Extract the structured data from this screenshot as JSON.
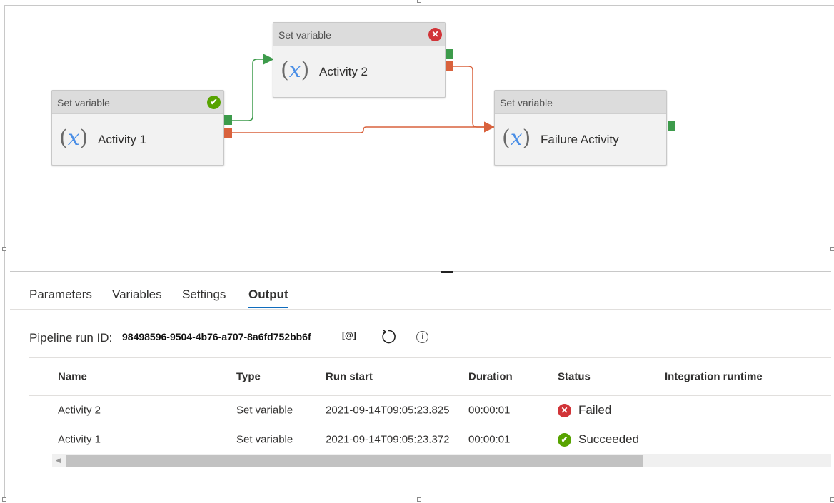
{
  "canvas": {
    "nodes": [
      {
        "id": "activity-1",
        "header": "Set variable",
        "name": "Activity 1",
        "fx_open": "(",
        "fx_var": "x",
        "fx_close": ")",
        "status": "succeeded"
      },
      {
        "id": "activity-2",
        "header": "Set variable",
        "name": "Activity 2",
        "fx_open": "(",
        "fx_var": "x",
        "fx_close": ")",
        "status": "failed"
      },
      {
        "id": "failure-activity",
        "header": "Set variable",
        "name": "Failure Activity",
        "fx_open": "(",
        "fx_var": "x",
        "fx_close": ")",
        "status": "none"
      }
    ],
    "status_glyphs": {
      "succeeded": "✔",
      "failed": "✕"
    },
    "colors": {
      "success": "#3d9b4b",
      "failure": "#d9623d",
      "failed_icon": "#d13438",
      "success_icon": "#57a300"
    }
  },
  "tabs": [
    {
      "label": "Parameters",
      "active": false
    },
    {
      "label": "Variables",
      "active": false
    },
    {
      "label": "Settings",
      "active": false
    },
    {
      "label": "Output",
      "active": true
    }
  ],
  "pipeline": {
    "run_id_label": "Pipeline run ID:",
    "run_id": "98498596-9504-4b76-a707-8a6fd752bb6f",
    "copy_icon_glyph": "[@]"
  },
  "table": {
    "columns": [
      "Name",
      "Type",
      "Run start",
      "Duration",
      "Status",
      "Integration runtime"
    ],
    "rows": [
      {
        "name": "Activity 2",
        "type": "Set variable",
        "run_start": "2021-09-14T09:05:23.825",
        "duration": "00:00:01",
        "status": "Failed",
        "status_icon": "error-icon",
        "integration_runtime": ""
      },
      {
        "name": "Activity 1",
        "type": "Set variable",
        "run_start": "2021-09-14T09:05:23.372",
        "duration": "00:00:01",
        "status": "Succeeded",
        "status_icon": "check-icon",
        "integration_runtime": ""
      }
    ]
  },
  "scrollbar": {
    "position": 0.0,
    "visible_fraction": 0.74
  }
}
